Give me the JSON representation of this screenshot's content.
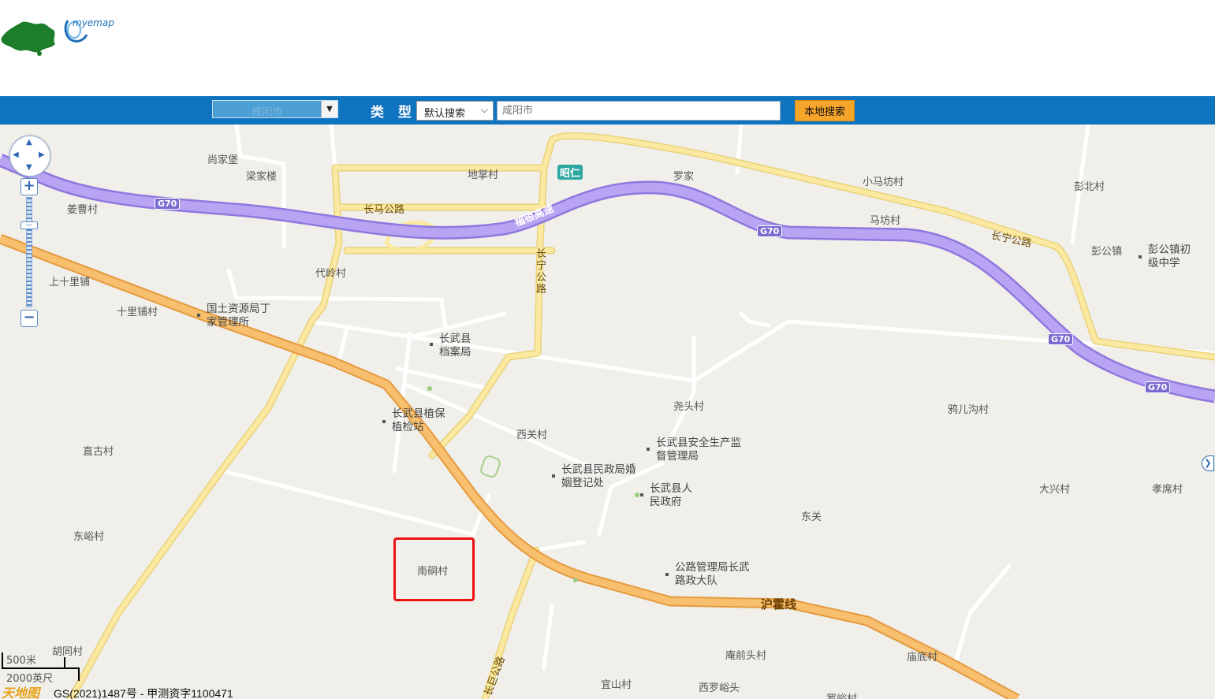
{
  "header": {
    "logo_text": "myemap"
  },
  "toolbar": {
    "city": "咸阳市",
    "type_label": "类 型",
    "type_value": "默认搜索",
    "search_placeholder": "咸阳市",
    "search_button": "本地搜索"
  },
  "map": {
    "highways": [
      {
        "name": "福银高速",
        "badge": "G70"
      },
      {
        "name": "沪霍线"
      }
    ],
    "road_labels": {
      "chang_ma": "长马公路",
      "chang_ning_v": "长宁公路",
      "chang_ning": "长宁公路",
      "fuyin": "福银高速",
      "huhuo": "沪霍线",
      "changju": "长巨公路",
      "g70": "G70",
      "zhaoren": "昭仁"
    },
    "places": {
      "shangjiabao": "尚家堡",
      "liangjialou": "梁家楼",
      "dizhangcun": "地掌村",
      "luojia": "罗家",
      "xiaomafang": "小马坊村",
      "pengbei": "彭北村",
      "jiangcao": "姜曹村",
      "mafang": "马坊村",
      "penggong": "彭公镇",
      "penggong_school": "彭公镇初级中学",
      "dailing": "代岭村",
      "shangshili": "上十里铺",
      "shilipu": "十里铺村",
      "guotu": "国土资源局丁家管理所",
      "dangan": "长武县档案局",
      "yaotou": "尧头村",
      "ya_er": "鸦儿沟村",
      "zhibao": "长武县植保植检站",
      "xiguan": "西关村",
      "anquan": "长武县安全生产监督管理局",
      "zhigu": "直古村",
      "minzheng": "长武县民政局婚姻登记处",
      "zhengfu": "长武县人民政府",
      "daxing": "大兴村",
      "xiaoxi": "孝席村",
      "dongguan": "东关",
      "dongyu": "东峪村",
      "nanjian": "南硐村",
      "gonglu": "公路管理局长武路政大队",
      "hutong": "胡同村",
      "anqiantou": "庵前头村",
      "miaodi": "庙底村",
      "yishan": "宜山村",
      "xiluoyu": "西罗峪头",
      "luoyu": "罗峪村"
    }
  },
  "scale": {
    "metric": "500米",
    "imperial": "2000英尺"
  },
  "copyright": "GS(2021)1487号 - 甲测资字1100471",
  "tdt_logo": "天地图",
  "colors": {
    "toolbar": "#0f74bf",
    "expressway": "#a38ef0",
    "national_road": "#f2b35e",
    "road": "#fbe9a2",
    "map_bg": "#f0efea",
    "highlight": "#e11111",
    "button": "#f7a42a"
  }
}
